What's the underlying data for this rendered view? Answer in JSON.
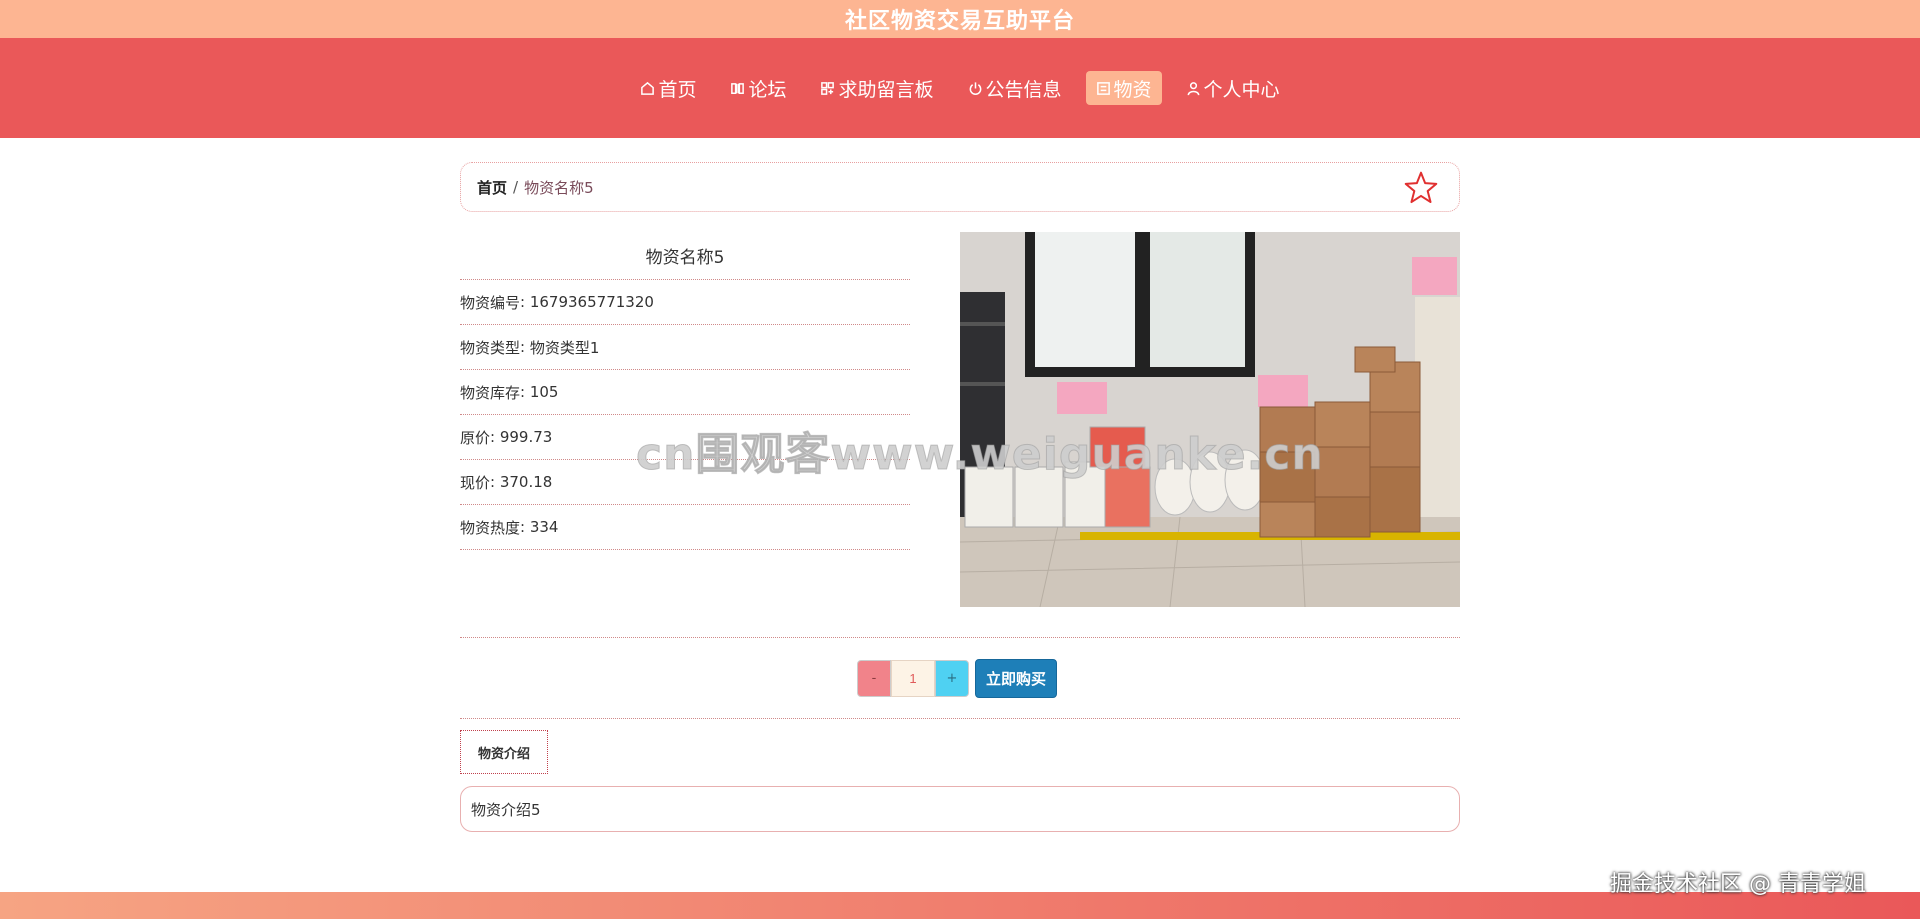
{
  "site": {
    "title": "社区物资交易互助平台"
  },
  "nav": [
    {
      "label": "首页",
      "icon": "home-icon",
      "active": false
    },
    {
      "label": "论坛",
      "icon": "book-icon",
      "active": false
    },
    {
      "label": "求助留言板",
      "icon": "grid-icon",
      "active": false
    },
    {
      "label": "公告信息",
      "icon": "power-icon",
      "active": false
    },
    {
      "label": "物资",
      "icon": "box-icon",
      "active": true
    },
    {
      "label": "个人中心",
      "icon": "user-icon",
      "active": false
    }
  ],
  "breadcrumb": {
    "home": "首页",
    "sep": "/",
    "current": "物资名称5"
  },
  "product": {
    "name": "物资名称5",
    "fields": [
      {
        "label": "物资编号",
        "value": "1679365771320"
      },
      {
        "label": "物资类型",
        "value": "物资类型1"
      },
      {
        "label": "物资库存",
        "value": "105"
      },
      {
        "label": "原价",
        "value": "999.73"
      },
      {
        "label": "现价",
        "value": "370.18"
      },
      {
        "label": "物资热度",
        "value": "334"
      }
    ]
  },
  "purchase": {
    "minus": "-",
    "quantity": "1",
    "plus": "+",
    "buy_label": "立即购买"
  },
  "tabs": {
    "intro": "物资介绍"
  },
  "description": "物资介绍5",
  "watermarks": {
    "center": "cn围观客www.weiguanke.cn",
    "corner": "掘金技术社区 @ 青青学姐"
  },
  "colors": {
    "header": "#fdb592",
    "nav": "#ea5859",
    "active_nav": "#fdb592",
    "buy_button": "#1e7fb8",
    "star": "#e03030"
  }
}
